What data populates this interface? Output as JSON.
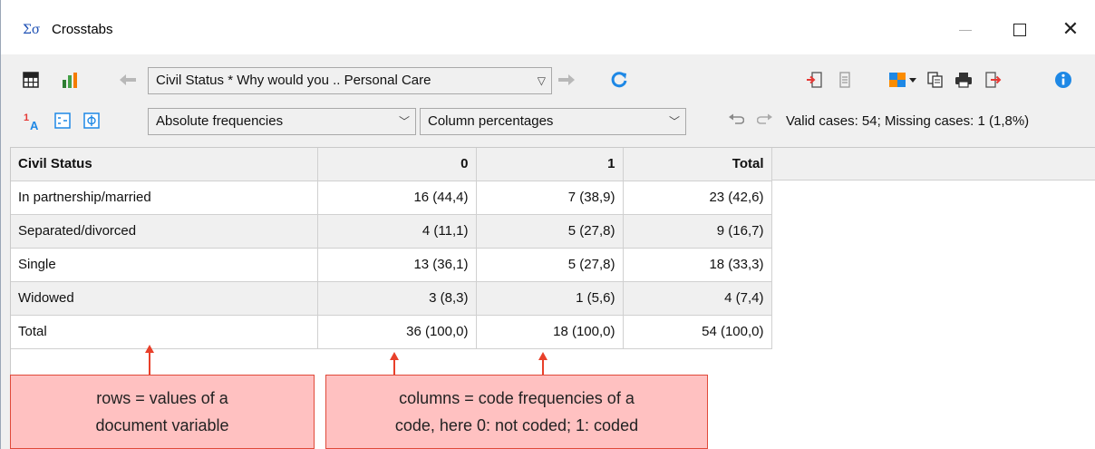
{
  "window": {
    "title": "Crosstabs",
    "app_icon": "Σσ"
  },
  "toolbar1": {
    "table_view_icon": "grid-icon",
    "chart_view_icon": "bar-chart-icon",
    "back_icon": "arrow-left-icon",
    "crosstab_select": "Civil Status * Why would you .. Personal Care",
    "forward_icon": "arrow-right-icon",
    "refresh_icon": "refresh-icon"
  },
  "toolbar2": {
    "display_select": "Absolute frequencies",
    "percent_select": "Column percentages",
    "status": "Valid cases: 54;  Missing cases: 1 (1,8%)"
  },
  "table": {
    "headers": [
      "Civil Status",
      "0",
      "1",
      "Total"
    ],
    "rows": [
      [
        "In partnership/married",
        "16 (44,4)",
        "7 (38,9)",
        "23 (42,6)"
      ],
      [
        "Separated/divorced",
        "4 (11,1)",
        "5 (27,8)",
        "9 (16,7)"
      ],
      [
        "Single",
        "13 (36,1)",
        "5 (27,8)",
        "18 (33,3)"
      ],
      [
        "Widowed",
        "3 (8,3)",
        "1 (5,6)",
        "4 (7,4)"
      ],
      [
        "Total",
        "36 (100,0)",
        "18 (100,0)",
        "54 (100,0)"
      ]
    ]
  },
  "callouts": {
    "rows": [
      "rows = values of a",
      "document variable"
    ],
    "columns": [
      "columns = code frequencies of a",
      "code, here 0: not coded; 1: coded"
    ]
  },
  "colors": {
    "accent_blue": "#1e88e5",
    "export_red": "#e53935",
    "callout_fill": "#ffc1c1",
    "callout_border": "#e04a3a"
  }
}
